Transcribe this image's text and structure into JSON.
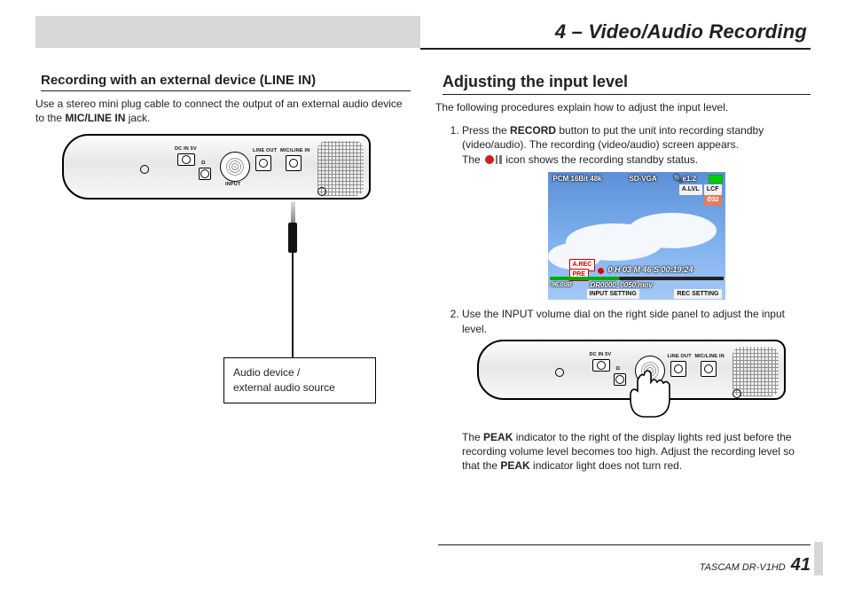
{
  "chapter_title": "4 – Video/Audio Recording",
  "left": {
    "heading": "Recording with an external device (LINE IN)",
    "intro_a": "Use a stereo mini plug cable to connect the output of an external audio device to the ",
    "intro_bold": "MIC/LINE IN",
    "intro_b": " jack.",
    "device_labels": {
      "dc": "DC IN 5V",
      "lineout": "LINE OUT",
      "micline": "MIC/LINE IN",
      "input": "INPUT",
      "hp": "Ω"
    },
    "box_line1": "Audio device /",
    "box_line2": "external audio source"
  },
  "right": {
    "heading": "Adjusting the input level",
    "intro": "The following procedures explain how to adjust the input level.",
    "step1_a": "Press the ",
    "step1_b": "RECORD",
    "step1_c": " button to put the unit into recording standby (video/audio). The recording (video/audio) screen appears.",
    "step1_d": "The ",
    "step1_e": " icon shows the recording standby status.",
    "lcd": {
      "top_left": "PCM 16Bit 48k",
      "top_mid": "SD-VGA",
      "top_zoom": "e1.2",
      "alvl": "A.LVL",
      "lcf": "LCF",
      "timer_icon": "32",
      "arec": "A.REC",
      "pre": "PRE",
      "time": "0 H 03 M 46 S 00:19:24",
      "db": "-96.0dB",
      "file": "DR0000_0050.mov",
      "btn_left": "INPUT SETTING",
      "btn_right": "REC SETTING"
    },
    "step2": "Use the INPUT volume dial on the right side panel to adjust the input level.",
    "peak_a": "The ",
    "peak_b": "PEAK",
    "peak_c": " indicator to the right of the display lights red just before the recording volume level becomes too high. Adjust the recording level so that the ",
    "peak_d": "PEAK",
    "peak_e": " indicator light does not turn red."
  },
  "footer": {
    "product": "TASCAM  DR-V1HD",
    "page": "41"
  }
}
